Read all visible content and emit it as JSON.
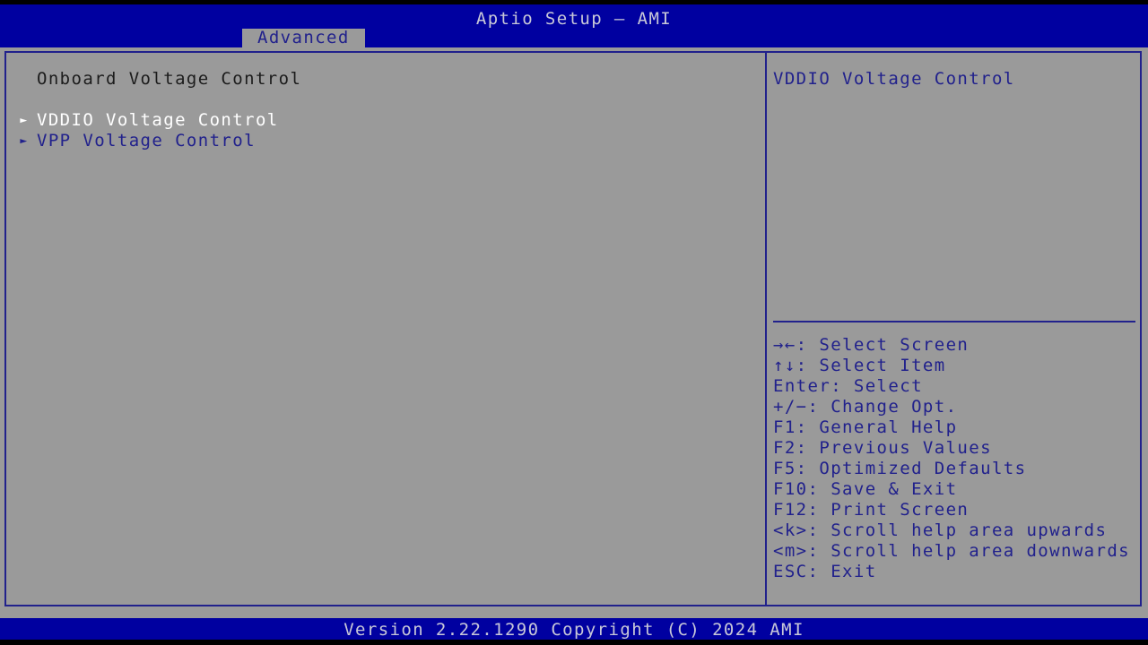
{
  "colors": {
    "blue": "#0000a0",
    "dark_blue_text": "#21218c",
    "gray_bg": "#9a9a9a",
    "light_text": "#c8c8d8",
    "white_text": "#ffffff",
    "black": "#000000"
  },
  "header": {
    "title": "Aptio Setup – AMI"
  },
  "tabs": [
    {
      "label": "Advanced",
      "active": true
    }
  ],
  "left_pane": {
    "section_heading": "Onboard Voltage Control",
    "items": [
      {
        "bullet": "submenu-triangle-icon",
        "label": "VDDIO Voltage Control",
        "selected": true
      },
      {
        "bullet": "submenu-triangle-icon",
        "label": "VPP Voltage Control",
        "selected": false
      }
    ]
  },
  "right_pane": {
    "help_text": "VDDIO Voltage Control",
    "legend": [
      "→←: Select Screen",
      "↑↓: Select Item",
      "Enter: Select",
      "+/−: Change Opt.",
      "F1: General Help",
      "F2: Previous Values",
      "F5: Optimized Defaults",
      "F10: Save & Exit",
      "F12: Print Screen",
      "<k>: Scroll help area upwards",
      "<m>: Scroll help area downwards",
      "ESC: Exit"
    ]
  },
  "footer": {
    "version_text": "Version 2.22.1290 Copyright (C) 2024 AMI"
  }
}
